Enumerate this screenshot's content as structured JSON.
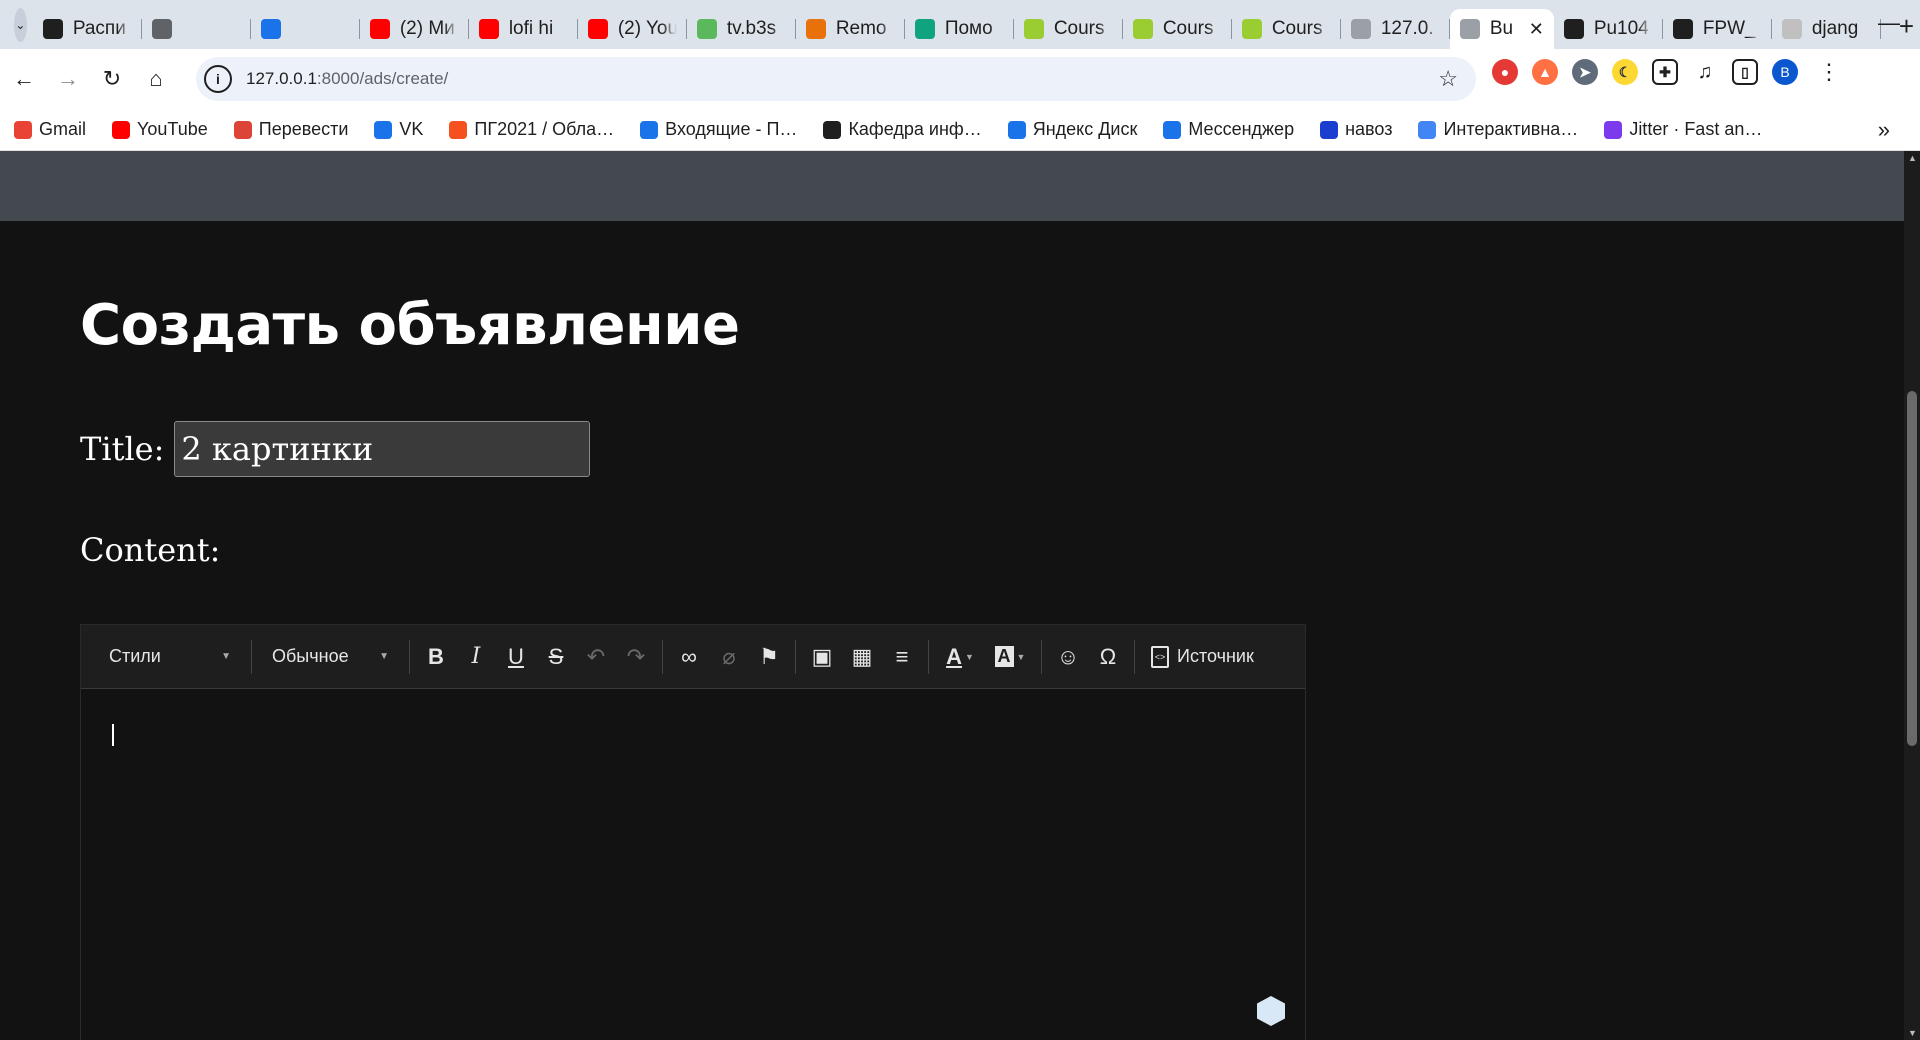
{
  "browser": {
    "tabs": [
      {
        "title": "Распи",
        "icon": "send-icon",
        "color": "#1f1f1f"
      },
      {
        "title": "",
        "icon": "app-icon",
        "color": "#5f6368"
      },
      {
        "title": "",
        "icon": "app-icon",
        "color": "#1a73e8"
      },
      {
        "title": "(2) Ми",
        "icon": "youtube-icon",
        "color": "#ff0000"
      },
      {
        "title": "lofi hi",
        "icon": "youtube-icon",
        "color": "#ff0000"
      },
      {
        "title": "(2) You",
        "icon": "youtube-icon",
        "color": "#ff0000"
      },
      {
        "title": "tv.b3s",
        "icon": "hd-icon",
        "color": "#5cb85c"
      },
      {
        "title": "Remo",
        "icon": "remote-icon",
        "color": "#e8710a"
      },
      {
        "title": "Помо",
        "icon": "openai-icon",
        "color": "#10a37f"
      },
      {
        "title": "Cours",
        "icon": "course-icon",
        "color": "#9acd32"
      },
      {
        "title": "Cours",
        "icon": "course-icon",
        "color": "#9acd32"
      },
      {
        "title": "Cours",
        "icon": "course-icon",
        "color": "#9acd32"
      },
      {
        "title": "127.0.",
        "icon": "globe-icon",
        "color": "#9aa0a6"
      },
      {
        "title": "Bu",
        "icon": "globe-icon",
        "color": "#9aa0a6",
        "active": true
      },
      {
        "title": "Pu104",
        "icon": "github-icon",
        "color": "#1f1f1f"
      },
      {
        "title": "FPW_",
        "icon": "layers-icon",
        "color": "#1f1f1f"
      },
      {
        "title": "djang",
        "icon": "cube-icon",
        "color": "#c0c0c0"
      }
    ],
    "url_host": "127.0.0.1",
    "url_rest": ":8000/ads/create/",
    "bookmarks": [
      {
        "label": "Gmail",
        "icon": "gmail-icon",
        "color": "#ea4335"
      },
      {
        "label": "YouTube",
        "icon": "youtube-icon",
        "color": "#ff0000"
      },
      {
        "label": "Перевести",
        "icon": "translate-icon",
        "color": "#db4437"
      },
      {
        "label": "VK",
        "icon": "chat-icon",
        "color": "#1a73e8"
      },
      {
        "label": "ПГ2021 / Обла…",
        "icon": "cloud-icon",
        "color": "#f4511e"
      },
      {
        "label": "Входящие - П…",
        "icon": "mail-icon",
        "color": "#1a73e8"
      },
      {
        "label": "Кафедра инф…",
        "icon": "send-icon",
        "color": "#1f1f1f"
      },
      {
        "label": "Яндекс Диск",
        "icon": "disk-icon",
        "color": "#1a73e8"
      },
      {
        "label": "Мессенджер",
        "icon": "chat-icon",
        "color": "#1a73e8"
      },
      {
        "label": "навоз",
        "icon": "m-icon",
        "color": "#1a3fd0"
      },
      {
        "label": "Интерактивна…",
        "icon": "google-icon",
        "color": "#4285f4"
      },
      {
        "label": "Jitter · Fast an…",
        "icon": "jitter-icon",
        "color": "#7c3aed"
      }
    ],
    "profile_initial": "B"
  },
  "page": {
    "title": "Создать объявление",
    "title_label": "Title:",
    "title_value": "2 картинки",
    "content_label": "Content:"
  },
  "editor": {
    "styles_label": "Стили",
    "format_label": "Обычное",
    "source_label": "Источник"
  }
}
